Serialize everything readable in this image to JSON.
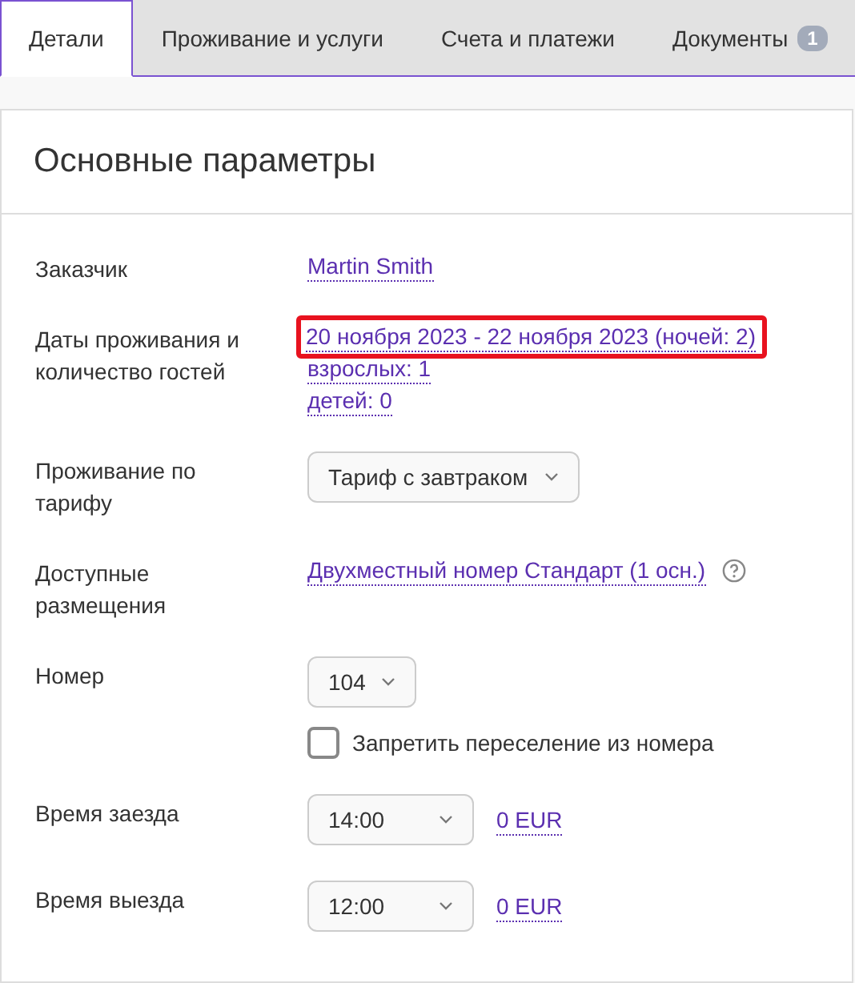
{
  "tabs": [
    {
      "label": "Детали",
      "selected": true
    },
    {
      "label": "Проживание и услуги",
      "selected": false
    },
    {
      "label": "Счета и платежи",
      "selected": false
    },
    {
      "label": "Документы",
      "selected": false,
      "badge": "1"
    }
  ],
  "section": {
    "title": "Основные параметры"
  },
  "rows": [
    {
      "label": "Заказчик",
      "lines": [
        [
          {
            "kind": "link",
            "text": "Martin Smith"
          }
        ]
      ]
    },
    {
      "label": "Даты проживания и количество гостей",
      "lines": [
        [
          {
            "kind": "link",
            "text": "20 ноября 2023 - 22 ноября 2023 (ночей: 2)",
            "highlighted": true
          }
        ],
        [
          {
            "kind": "link",
            "text": "взрослых: 1"
          }
        ],
        [
          {
            "kind": "link",
            "text": "детей: 0"
          }
        ]
      ]
    },
    {
      "label": "Проживание по тарифу",
      "lines": [
        [
          {
            "kind": "select",
            "text": "Тариф с завтраком"
          }
        ]
      ]
    },
    {
      "label": "Доступные размещения",
      "lines": [
        [
          {
            "kind": "link",
            "text": "Двухместный номер Стандарт (1 осн.)"
          },
          {
            "kind": "help"
          }
        ]
      ]
    },
    {
      "label": "Номер",
      "lines": [
        [
          {
            "kind": "select",
            "text": "104"
          }
        ],
        [
          {
            "kind": "checkbox",
            "text": "Запретить переселение из номера",
            "checked": false
          }
        ]
      ]
    },
    {
      "label": "Время заезда",
      "lines": [
        [
          {
            "kind": "select",
            "text": "14:00"
          },
          {
            "kind": "link",
            "text": "0 EUR"
          }
        ]
      ]
    },
    {
      "label": "Время выезда",
      "lines": [
        [
          {
            "kind": "select",
            "text": "12:00"
          },
          {
            "kind": "link",
            "text": "0 EUR"
          }
        ]
      ]
    }
  ]
}
